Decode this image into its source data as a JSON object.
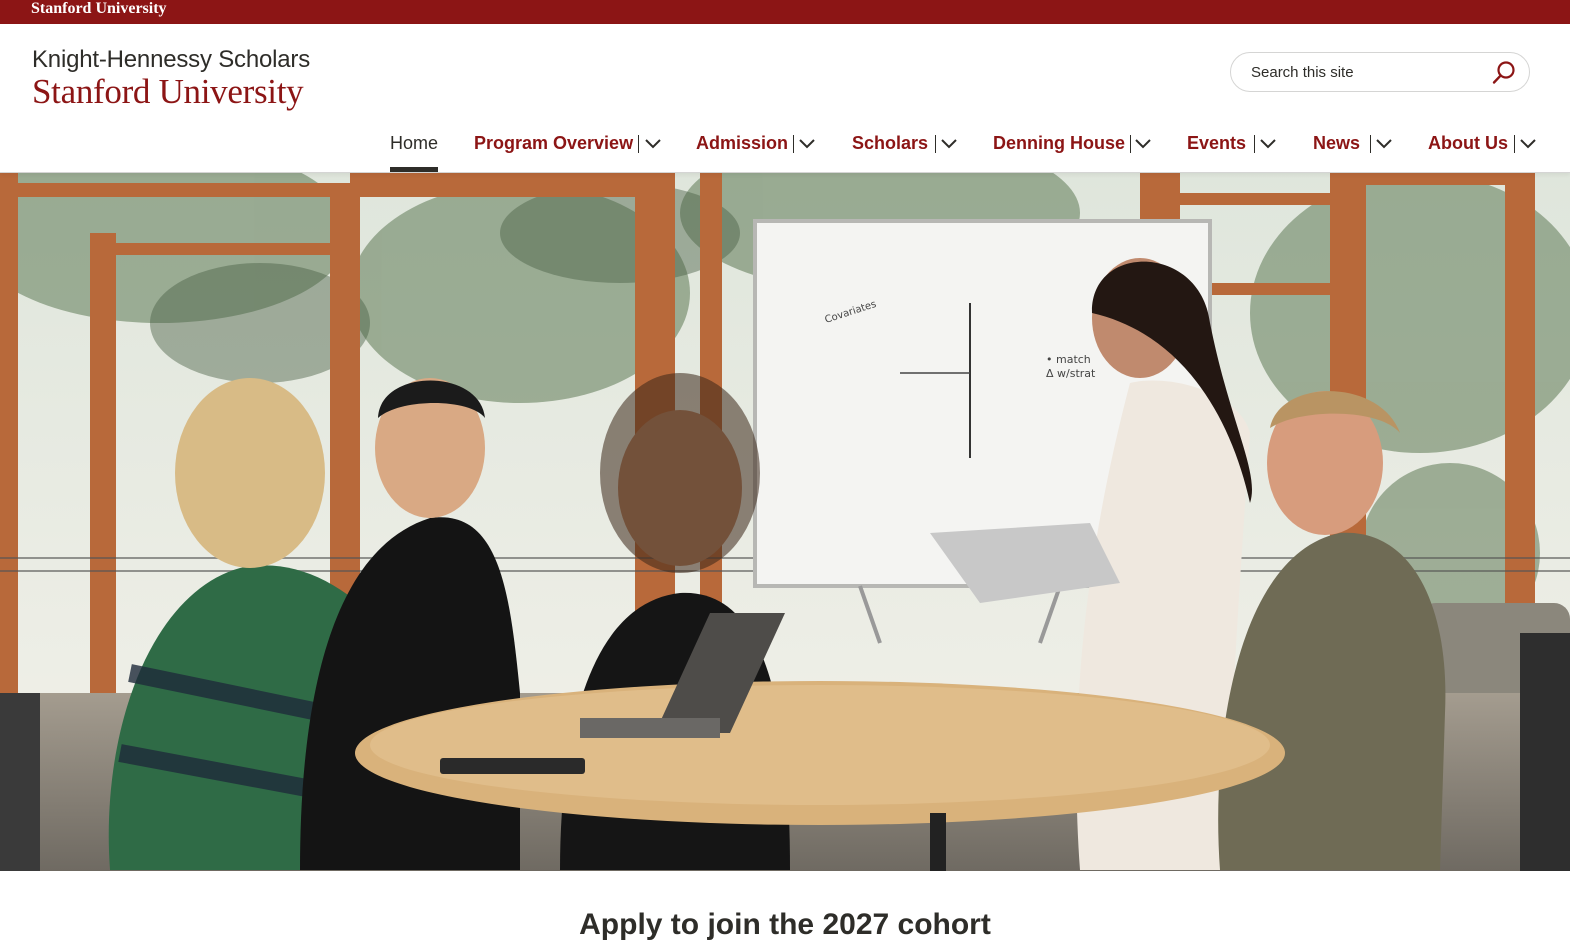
{
  "global_bar": {
    "label": "Stanford University"
  },
  "logo": {
    "line1": "Knight-Hennessy Scholars",
    "line2": "Stanford University"
  },
  "search": {
    "placeholder": "Search this site",
    "icon": "search-icon"
  },
  "nav": {
    "items": [
      {
        "label": "Home",
        "active": true
      },
      {
        "label": "Program Overview"
      },
      {
        "label": "Admission"
      },
      {
        "label": "Scholars"
      },
      {
        "label": "Denning House"
      },
      {
        "label": "Events"
      },
      {
        "label": "News"
      },
      {
        "label": "About Us"
      }
    ],
    "dropdown_icon": "chevron-down-icon"
  },
  "hero": {
    "whiteboard_notes": [
      "Covariates",
      "• match",
      "Δ w/strat"
    ]
  },
  "apply": {
    "heading": "Apply to join the 2027 cohort"
  },
  "colors": {
    "cardinal": "#8c1515",
    "text": "#2e2d29",
    "white": "#ffffff"
  }
}
